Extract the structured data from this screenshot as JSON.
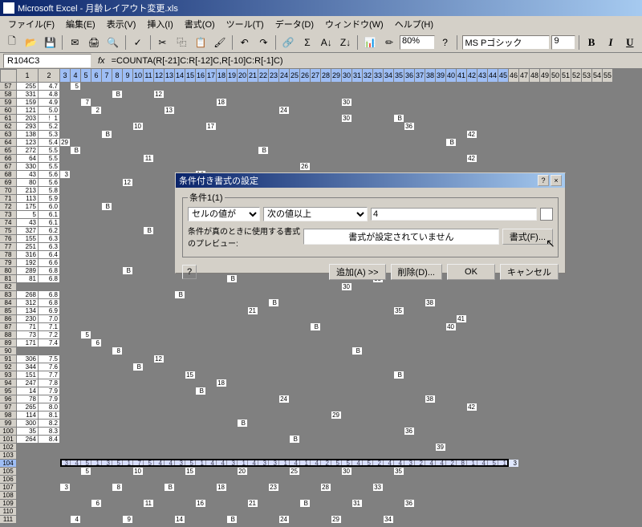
{
  "app": {
    "title": "Microsoft Excel - 月齢レイアウト変更.xls"
  },
  "menu": {
    "file": "ファイル(F)",
    "edit": "編集(E)",
    "view": "表示(V)",
    "insert": "挿入(I)",
    "format": "書式(O)",
    "tools": "ツール(T)",
    "data": "データ(D)",
    "window": "ウィンドウ(W)",
    "help": "ヘルプ(H)"
  },
  "toolbar": {
    "zoom": "80%",
    "font": "MS Pゴシック",
    "fontsize": "9",
    "bold": "B",
    "italic": "I",
    "underline": "U"
  },
  "formula": {
    "namebox": "R104C3",
    "fx": "fx",
    "text": "=COUNTA(R[-21]C:R[-12]C,R[-10]C:R[-1]C)"
  },
  "columns": {
    "nums": [
      "1",
      "2",
      "3",
      "4",
      "5",
      "6",
      "7",
      "8",
      "9",
      "10",
      "11",
      "12",
      "13",
      "14",
      "15",
      "16",
      "17",
      "18",
      "19",
      "20",
      "21",
      "22",
      "23",
      "24",
      "25",
      "26",
      "27",
      "28",
      "29",
      "30",
      "31",
      "32",
      "33",
      "34",
      "35",
      "36",
      "37",
      "38",
      "39",
      "40",
      "41",
      "42",
      "43",
      "44",
      "45",
      "46",
      "47",
      "48",
      "49",
      "50",
      "51",
      "52",
      "53",
      "54",
      "55"
    ]
  },
  "rows": {
    "start": 57,
    "selected": 104
  },
  "selrow_data": [
    "3",
    "4",
    "5",
    "1",
    "3",
    "5",
    "1",
    "7",
    "5",
    "4",
    "4",
    "3",
    "5",
    "1",
    "4",
    "4",
    "3",
    "1",
    "4",
    "3",
    "3",
    "1",
    "4",
    "1",
    "4",
    "2",
    "5",
    "5",
    "4",
    "5",
    "2",
    "4",
    "4",
    "3",
    "2",
    "4",
    "4",
    "2",
    "8",
    "1",
    "4",
    "5",
    "1",
    "3"
  ],
  "sample_cells": {
    "col1": [
      "255",
      "331",
      "159",
      "121",
      "203",
      "293",
      "138",
      "123",
      "272",
      "64",
      "330",
      "43",
      "80",
      "213",
      "113",
      "175",
      "5",
      "43",
      "327",
      "155",
      "251",
      "316",
      "192",
      "289",
      "81",
      "",
      "268",
      "312",
      "134",
      "230",
      "71",
      "73",
      "171",
      "",
      "306",
      "344",
      "151",
      "247",
      "14",
      "78",
      "265",
      "114",
      "300",
      "35",
      "264",
      ""
    ],
    "col2": [
      "4.7",
      "4.8",
      "4.9",
      "5.0",
      "5.1",
      "5.2",
      "5.3",
      "5.4",
      "5.5",
      "5.5",
      "5.5",
      "5.6",
      "5.6",
      "5.8",
      "5.9",
      "6.0",
      "6.1",
      "6.1",
      "6.2",
      "6.3",
      "6.3",
      "6.4",
      "6.6",
      "6.8",
      "6.8",
      "",
      "6.8",
      "6.8",
      "6.9",
      "7.0",
      "7.1",
      "7.2",
      "7.4",
      "",
      "7.5",
      "7.6",
      "7.7",
      "7.8",
      "7.9",
      "7.9",
      "8.0",
      "8.1",
      "8.2",
      "8.3",
      "8.4",
      ""
    ]
  },
  "dialog": {
    "title": "条件付き書式の設定",
    "legend": "条件1(1)",
    "sel1": "セルの値が",
    "sel2": "次の値以上",
    "val": "4",
    "preview_label": "条件が真のときに使用する書式のプレビュー:",
    "preview_text": "書式が設定されていません",
    "format_btn": "書式(F)...",
    "add_btn": "追加(A) >>",
    "delete_btn": "削除(D)...",
    "ok_btn": "OK",
    "cancel_btn": "キャンセル",
    "help": "?",
    "close": "×"
  }
}
